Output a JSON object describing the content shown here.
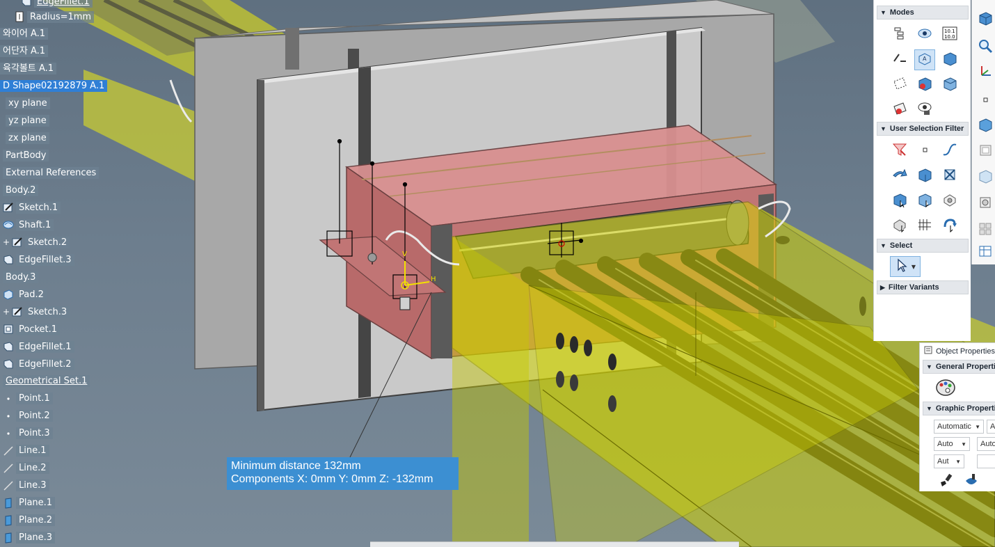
{
  "tree": [
    {
      "label": "EdgeFillet.1",
      "icon": "fillet-icon",
      "underline": true
    },
    {
      "label": "Radius=1mm",
      "icon": "parameter-icon"
    },
    {
      "label": "와이어 A.1",
      "icon": "none"
    },
    {
      "label": "어단자 A.1",
      "icon": "none"
    },
    {
      "label": "육각볼트 A.1",
      "icon": "none"
    },
    {
      "label": "D Shape02192879 A.1",
      "icon": "none",
      "selected": true
    },
    {
      "label": "xy plane",
      "icon": "none"
    },
    {
      "label": "yz plane",
      "icon": "none"
    },
    {
      "label": "zx plane",
      "icon": "none"
    },
    {
      "label": "PartBody",
      "icon": "none"
    },
    {
      "label": "External References",
      "icon": "none"
    },
    {
      "label": "Body.2",
      "icon": "none"
    },
    {
      "label": "Sketch.1",
      "icon": "sketch-icon"
    },
    {
      "label": "Shaft.1",
      "icon": "shaft-icon"
    },
    {
      "label": "Sketch.2",
      "icon": "sketch-icon",
      "expander": true
    },
    {
      "label": "EdgeFillet.3",
      "icon": "fillet-icon"
    },
    {
      "label": "Body.3",
      "icon": "none"
    },
    {
      "label": "Pad.2",
      "icon": "pad-icon"
    },
    {
      "label": "Sketch.3",
      "icon": "sketch-icon",
      "expander": true
    },
    {
      "label": "Pocket.1",
      "icon": "pocket-icon"
    },
    {
      "label": "EdgeFillet.1",
      "icon": "fillet-icon"
    },
    {
      "label": "EdgeFillet.2",
      "icon": "fillet-icon"
    },
    {
      "label": "Geometrical Set.1",
      "icon": "none",
      "underline": true
    },
    {
      "label": "Point.1",
      "icon": "point-icon"
    },
    {
      "label": "Point.2",
      "icon": "point-icon"
    },
    {
      "label": "Point.3",
      "icon": "point-icon"
    },
    {
      "label": "Line.1",
      "icon": "line-icon"
    },
    {
      "label": "Line.2",
      "icon": "line-icon"
    },
    {
      "label": "Line.3",
      "icon": "line-icon"
    },
    {
      "label": "Plane.1",
      "icon": "plane-icon"
    },
    {
      "label": "Plane.2",
      "icon": "plane-icon"
    },
    {
      "label": "Plane.3",
      "icon": "plane-icon"
    }
  ],
  "measure": {
    "line1": "Minimum distance 132mm",
    "line2": "Components  X: 0mm Y: 0mm Z: -132mm"
  },
  "axes": {
    "v": "V",
    "h": "H"
  },
  "toolbar": {
    "modes_label": "Modes",
    "filter_label": "User Selection Filter",
    "select_label": "Select",
    "variants_label": "Filter Variants",
    "modes_buttons": [
      "spec-tree-icon",
      "show-hide-icon",
      "numeric-display-icon",
      "swap-icon",
      "annotation-mode-icon",
      "solid-box-icon",
      "dashed-plane-icon",
      "red-solid-icon",
      "wire-box-icon",
      "hidden-red-icon",
      "lock-view-icon"
    ],
    "filter_buttons": [
      "red-funnel-icon",
      "point-filter-icon",
      "curve-filter-icon",
      "arrow-filter-icon",
      "volume-filter-icon",
      "edge-filter-icon",
      "box-select-icon",
      "face-select-icon",
      "gear-select-icon",
      "multi-select-icon",
      "grid-select-icon",
      "rotate-select-icon"
    ],
    "select_buttons": [
      "cursor-select-icon"
    ]
  },
  "properties": {
    "title": "Object Properties",
    "general": "General Properties",
    "graphic": "Graphic Properties",
    "drop1": "Automatic",
    "drop2": "Auto",
    "drop3": "Aut",
    "drop1b": "A",
    "drop2b": "Auto",
    "drop3b": ""
  },
  "colors": {
    "tray_yellow": "#cfd100",
    "part_red": "#c46a6a",
    "panel_gray": "#b9b9b9",
    "selection_blue": "#2f7fd6",
    "measure_blue": "#3c8fd2"
  }
}
